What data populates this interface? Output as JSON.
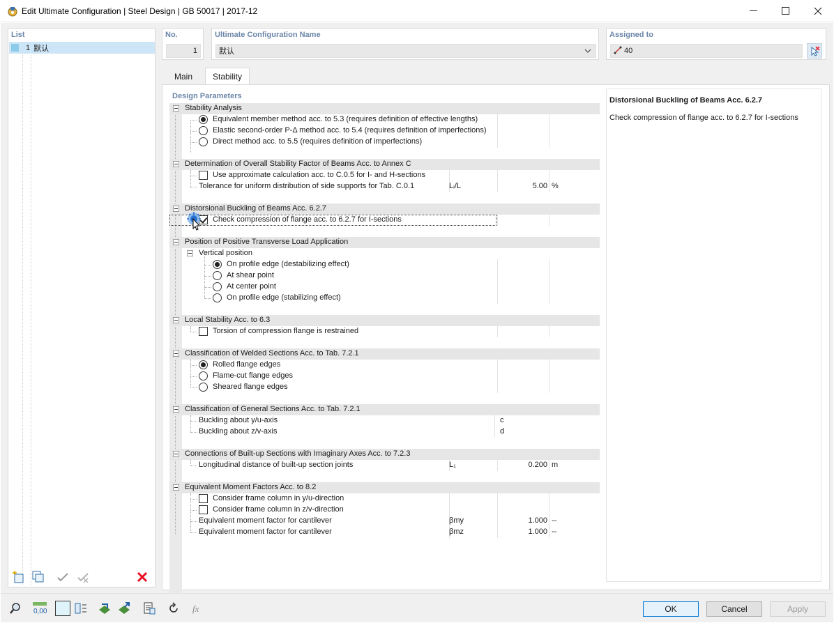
{
  "window": {
    "title": "Edit Ultimate Configuration | Steel Design | GB 50017 | 2017-12"
  },
  "list": {
    "header": "List",
    "items": [
      {
        "number": "1",
        "name": "默认"
      }
    ]
  },
  "header_fields": {
    "no_label": "No.",
    "no_value": "1",
    "name_label": "Ultimate Configuration Name",
    "name_value": "默认",
    "assigned_label": "Assigned to",
    "assigned_value": "40"
  },
  "tabs": [
    {
      "label": "Main",
      "active": false
    },
    {
      "label": "Stability",
      "active": true
    }
  ],
  "design_parameters": {
    "header": "Design Parameters",
    "stability_analysis": {
      "title": "Stability Analysis",
      "opt1": "Equivalent member method acc. to 5.3 (requires definition of effective lengths)",
      "opt2": "Elastic second-order P-Δ method acc. to 5.4 (requires definition of imperfections)",
      "opt3": "Direct method acc. to 5.5 (requires definition of imperfections)",
      "selected": 1
    },
    "overall_stability": {
      "title": "Determination of Overall Stability Factor of Beams Acc. to Annex C",
      "check_label": "Use approximate calculation acc. to C.0.5 for I- and H-sections",
      "checked": false,
      "tolerance_label": "Tolerance for uniform distribution of side supports for Tab. C.0.1",
      "tolerance_symbol": "Lᵢ/L",
      "tolerance_value": "5.00",
      "tolerance_unit": "%"
    },
    "distortional": {
      "title": "Distorsional Buckling of Beams Acc. 6.2.7",
      "check_label": "Check compression of flange acc. to 6.2.7 for I-sections",
      "checked": true
    },
    "load_position": {
      "title": "Position of Positive Transverse Load Application",
      "sub_title": "Vertical position",
      "opt1": "On profile edge (destabilizing effect)",
      "opt2": "At shear point",
      "opt3": "At center point",
      "opt4": "On profile edge (stabilizing effect)",
      "selected": 1
    },
    "local_stability": {
      "title": "Local Stability Acc. to 6.3",
      "check_label": "Torsion of compression flange is restrained",
      "checked": false
    },
    "welded": {
      "title": "Classification of Welded Sections Acc. to Tab. 7.2.1",
      "opt1": "Rolled flange edges",
      "opt2": "Flame-cut flange edges",
      "opt3": "Sheared flange edges",
      "selected": 1
    },
    "general": {
      "title": "Classification of General Sections Acc. to Tab. 7.2.1",
      "y_label": "Buckling about y/u-axis",
      "y_value": "c",
      "z_label": "Buckling about z/v-axis",
      "z_value": "d"
    },
    "builtup": {
      "title": "Connections of Built-up Sections with Imaginary Axes Acc. to 7.2.3",
      "label": "Longitudinal distance of built-up section joints",
      "symbol": "L₁",
      "value": "0.200",
      "unit": "m"
    },
    "moment": {
      "title": "Equivalent Moment Factors Acc. to 8.2",
      "check_y": "Consider frame column in y/u-direction",
      "check_z": "Consider frame column in z/v-direction",
      "factor_label": "Equivalent moment factor for cantilever",
      "sym_my": "βmy",
      "val_my": "1.000",
      "unit_my": "--",
      "sym_mz": "βmz",
      "val_mz": "1.000",
      "unit_mz": "--"
    }
  },
  "info": {
    "title": "Distorsional Buckling of Beams Acc. 6.2.7",
    "text": "Check compression of flange acc. to 6.2.7 for I-sections"
  },
  "buttons": {
    "ok": "OK",
    "cancel": "Cancel",
    "apply": "Apply"
  },
  "colors": {
    "accent": "#0078d7",
    "header_text": "#6b86a8",
    "selection": "#cde6f7",
    "delete": "#e81123"
  }
}
